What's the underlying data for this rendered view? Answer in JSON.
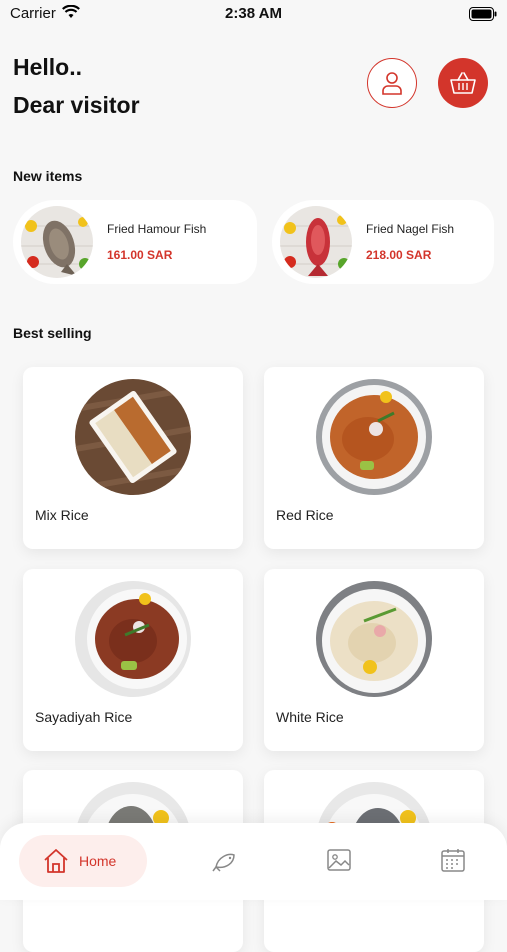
{
  "status_bar": {
    "carrier": "Carrier",
    "time": "2:38 AM"
  },
  "header": {
    "greeting_line1": "Hello..",
    "greeting_line2": "Dear visitor"
  },
  "new_items": {
    "title": "New items",
    "items": [
      {
        "name": "Fried Hamour Fish",
        "price": "161.00 SAR"
      },
      {
        "name": "Fried Nagel Fish",
        "price": "218.00 SAR"
      }
    ]
  },
  "best_selling": {
    "title": "Best selling",
    "items": [
      {
        "name": "Mix Rice"
      },
      {
        "name": "Red Rice"
      },
      {
        "name": "Sayadiyah Rice"
      },
      {
        "name": "White Rice"
      }
    ]
  },
  "tab_bar": {
    "home_label": "Home"
  },
  "colors": {
    "accent": "#d3352b",
    "accent_soft": "#fdeeec"
  }
}
